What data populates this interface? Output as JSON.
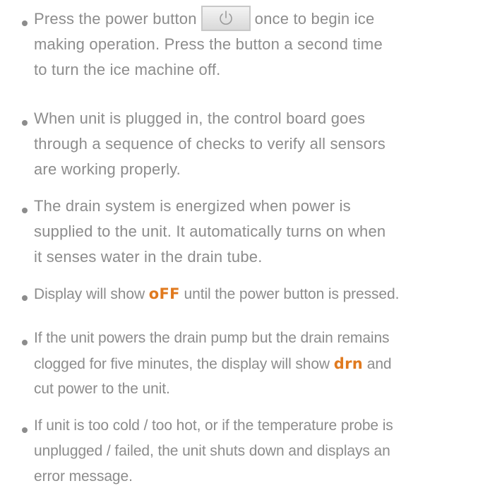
{
  "bullets": [
    {
      "lines": [
        {
          "before": "Press the power button",
          "after": "once to begin ice"
        },
        "making operation. Press the button a second time",
        "to turn the ice machine off."
      ],
      "icon": "power-icon"
    },
    {
      "lines": [
        "When unit is plugged in, the control board goes",
        "through a sequence of checks to verify all sensors",
        "are working properly."
      ]
    },
    {
      "lines": [
        "The drain system is energized when power is",
        "supplied to the unit. It automatically turns on when",
        "it senses water in the drain tube."
      ]
    },
    {
      "before": "Display will show",
      "code": "oFF",
      "after": "until the power button is pressed."
    },
    {
      "line1": "If the unit powers the drain pump but the drain remains",
      "line2_before": "clogged for five minutes, the display will show",
      "code": "drn",
      "line2_after": "and",
      "line3": "cut power to the unit."
    },
    {
      "lines": [
        "If unit is too cold / too hot, or if the temperature probe is",
        "unplugged / failed, the unit shuts down and displays an",
        "error message."
      ]
    }
  ],
  "colors": {
    "text": "#8c8c8c",
    "code": "#e07a1f"
  }
}
